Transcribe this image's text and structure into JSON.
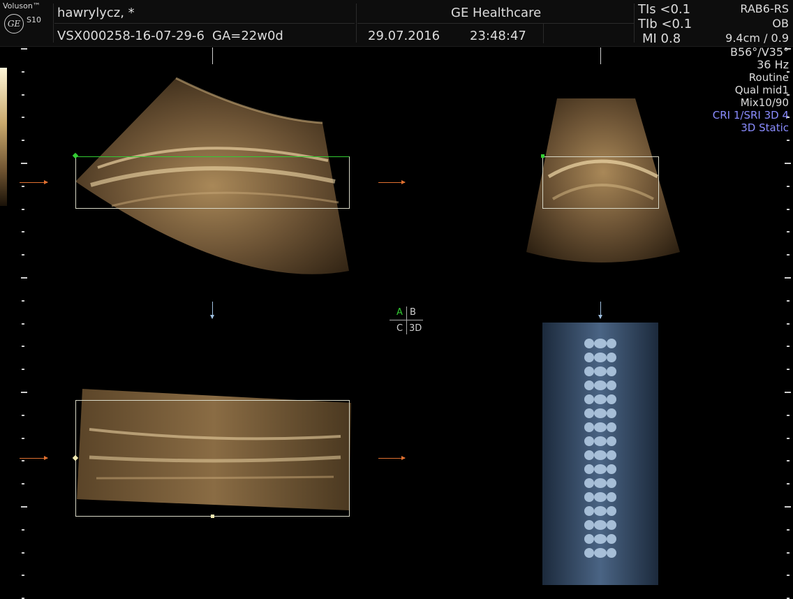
{
  "header": {
    "brand": "Voluson™",
    "logo": "GE",
    "model": "S10",
    "patient": "hawrylycz,   *",
    "exam_id": "VSX000258-16-07-29-6",
    "ga": "GA=22w0d",
    "company": "GE Healthcare",
    "date": "29.07.2016",
    "time": "23:48:47",
    "tis": "TIs <0.1",
    "tib": "TIb <0.1",
    "mi": "MI  0.8"
  },
  "params": {
    "probe": "RAB6-RS",
    "app": "OB",
    "depth": "9.4cm / 0.9",
    "angles": "B56°/V35°",
    "rate": "36 Hz",
    "mode": "Routine",
    "quality": "Qual mid1",
    "mix": "Mix10/90",
    "cri": "CRI 1/SRI 3D 4",
    "static": "3D Static"
  },
  "view_selector": {
    "a": "A",
    "b": "B",
    "c": "C",
    "d": "3D",
    "active": "A"
  },
  "colors": {
    "accent_blue": "#8a8cff",
    "roi_green": "#33cc33",
    "arrow_orange": "#e07030",
    "sepia_light": "#e8cfa0"
  },
  "icons": [
    "ge-logo-icon",
    "right-arrow-icon",
    "down-arrow-icon"
  ]
}
